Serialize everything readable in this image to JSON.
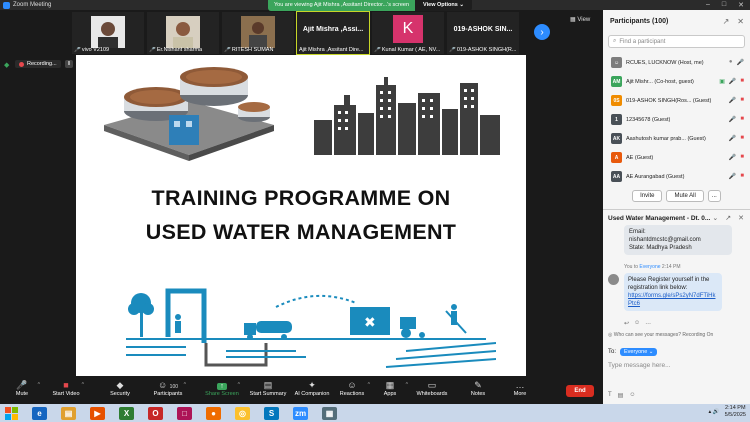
{
  "window": {
    "title": "Zoom Meeting",
    "controls": [
      "–",
      "□",
      "✕"
    ]
  },
  "share_banner": {
    "message": "You are viewing Ajit Mishra ,Assitant Director...'s screen",
    "options_label": "View Options ⌄"
  },
  "thumbnails": [
    {
      "name": "vivo V2109",
      "type": "photo"
    },
    {
      "name": "Er.Nishant sharma",
      "type": "photo"
    },
    {
      "name": "RITESH SUMAN",
      "type": "photo"
    },
    {
      "name": "Ajit Mishra ,Assitant Dire...",
      "title": "Ajit Mishra ,Assi...",
      "type": "name",
      "active": true
    },
    {
      "name": "Kunal Kumar ( AE, NV...",
      "avatar_letter": "K",
      "type": "avatar"
    },
    {
      "name": "019-ASHOK SINGH(R...",
      "title": "019-ASHOK SIN...",
      "type": "name"
    }
  ],
  "view_label": "View",
  "recording": {
    "label": "Recording...",
    "pause": "II",
    "stop": "■"
  },
  "slide": {
    "title_line1": "TRAINING PROGRAMME ON",
    "title_line2": "USED WATER MANAGEMENT"
  },
  "participants": {
    "header": "Participants (100)",
    "search_placeholder": "Find a participant",
    "list": [
      {
        "initials": "",
        "name": "RCUES, LUCKNOW (Host, me)",
        "color": "#7d7d7d"
      },
      {
        "initials": "AM",
        "name": "Ajit Mishr... (Co-host, guest)",
        "color": "#3ba55c"
      },
      {
        "initials": "0S",
        "name": "019-ASHOK SINGH(Ros... (Guest)",
        "color": "#f08c00"
      },
      {
        "initials": "1",
        "name": "12345678 (Guest)",
        "color": "#495057"
      },
      {
        "initials": "AK",
        "name": "Aashutosh kumar prab... (Guest)",
        "color": "#495057"
      },
      {
        "initials": "A",
        "name": "AE (Guest)",
        "color": "#e8590c"
      },
      {
        "initials": "AA",
        "name": "AE Aurangabad (Guest)",
        "color": "#495057"
      }
    ],
    "invite_label": "Invite",
    "mute_all_label": "Mute All",
    "more_label": "..."
  },
  "chat": {
    "header": "Used Water Management - Dt. 0...",
    "message1": {
      "lines": [
        "Email:",
        "nishantdmcstc@gmail.com",
        "State: Madhya Pradesh"
      ]
    },
    "meta": {
      "prefix": "You to",
      "to": "Everyone",
      "time": "2:14 PM"
    },
    "message2": {
      "text": "Please Register yourself in the registration link below:",
      "link": "https://forms.gle/sPs2yN7dFTiHkPtc6"
    },
    "who_can_see": "Who can see your messages? Recording On",
    "to_label": "To:",
    "to_value": "Everyone ⌄",
    "input_placeholder": "Type message here..."
  },
  "toolbar": {
    "mute": "Mute",
    "stop_video": "Start Video",
    "security": "Security",
    "participants": "Participants",
    "participants_count": "100",
    "share": "Share Screen",
    "summary": "Start Summary",
    "ai": "AI Companion",
    "reactions": "Reactions",
    "apps": "Apps",
    "whiteboards": "Whiteboards",
    "notes": "Notes",
    "more": "More",
    "end": "End"
  },
  "taskbar": {
    "time": "2:14 PM",
    "date": "5/5/2025"
  },
  "colors": {
    "zoom_blue": "#2d8cff",
    "share_green": "#3ba55c",
    "end_red": "#d92d20",
    "water_blue": "#1a8bbd"
  }
}
